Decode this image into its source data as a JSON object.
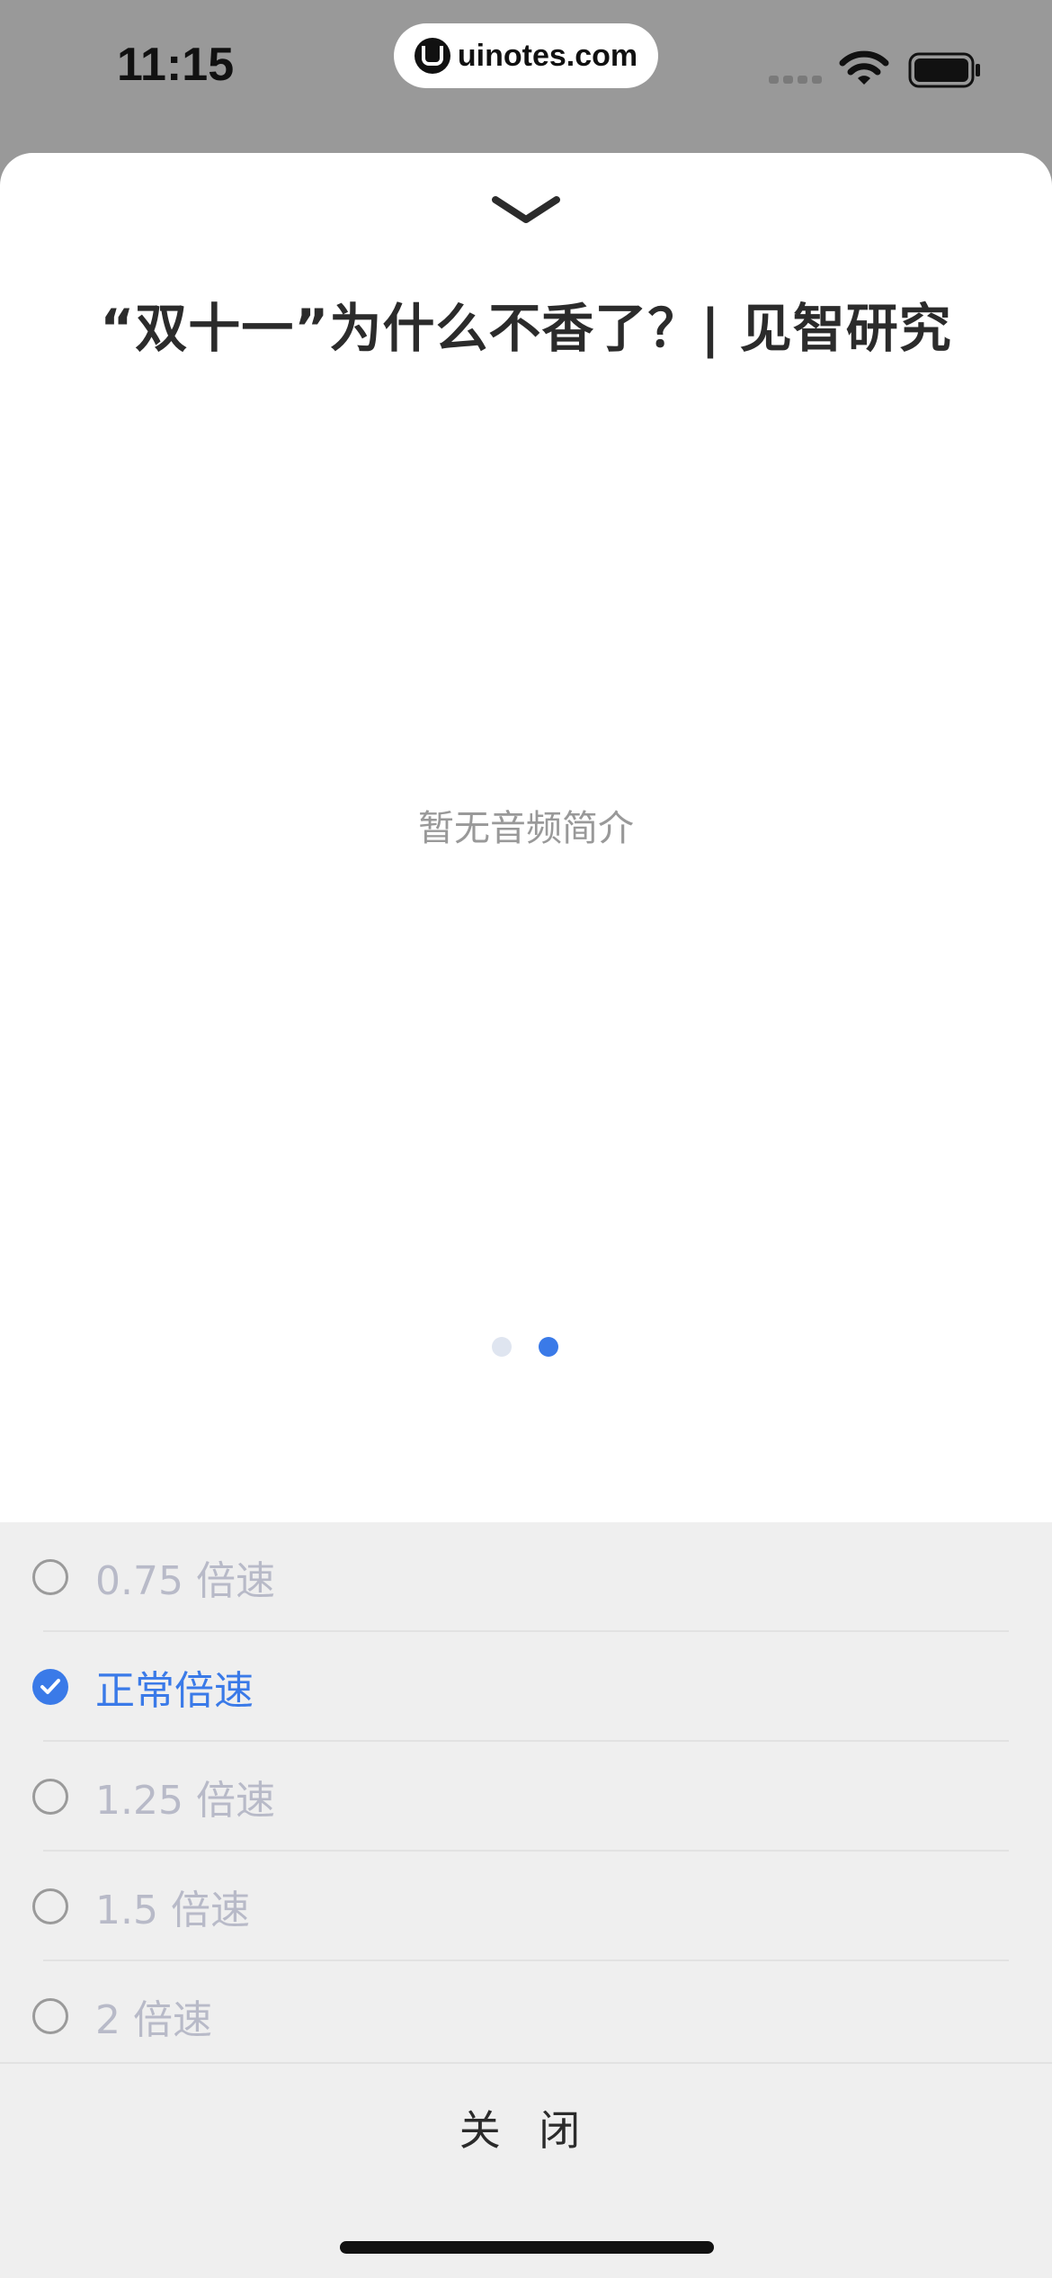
{
  "status_bar": {
    "time": "11:15",
    "url": "uinotes.com",
    "icons": [
      "signal-icon",
      "wifi-icon",
      "battery-icon"
    ]
  },
  "sheet": {
    "title": "“双十一”为什么不香了？| 见智研究",
    "empty_text": "暂无音频简介",
    "pager": {
      "total": 2,
      "active": 2
    }
  },
  "speed_options": [
    {
      "label": "0.75 倍速",
      "selected": false
    },
    {
      "label": "正常倍速",
      "selected": true
    },
    {
      "label": "1.25 倍速",
      "selected": false
    },
    {
      "label": "1.5 倍速",
      "selected": false
    },
    {
      "label": "2 倍速",
      "selected": false
    }
  ],
  "close_label": "关 闭",
  "colors": {
    "accent": "#3a7ae8",
    "overlay": "#999999",
    "panel_bg": "#efefef",
    "inactive_text": "#b8bac8"
  }
}
